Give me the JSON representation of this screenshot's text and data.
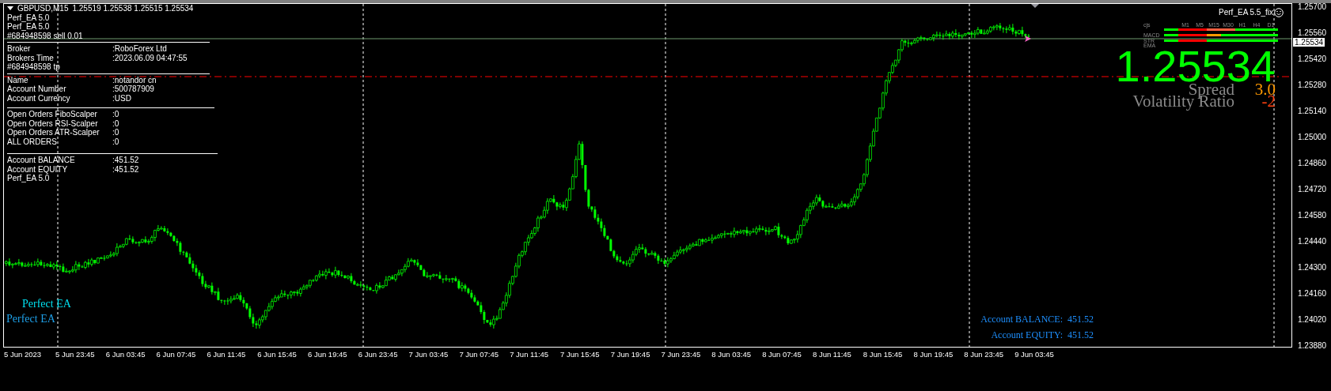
{
  "chart_header": {
    "symbol": "GBPUSD,M15",
    "quotes": "1.25519 1.25538 1.25515 1.25534"
  },
  "ea_labels": [
    "Perf_EA 5.0",
    "Perf_EA 5.0"
  ],
  "order_labels": [
    {
      "kind": "entry",
      "text": "#684948598 sell 0.01"
    },
    {
      "kind": "tp",
      "text": "#684948598 tp"
    }
  ],
  "info_sections": [
    {
      "rows": [
        {
          "label": "Broker",
          "value": ":RoboForex Ltd"
        },
        {
          "label": "Brokers Time",
          "value": ":2023.06.09 04:47:55"
        }
      ]
    },
    {
      "rows": [
        {
          "label": "Name",
          "value": ":notandor cn"
        },
        {
          "label": "Account Number",
          "value": ":500787909"
        },
        {
          "label": "Account Currency",
          "value": ":USD"
        }
      ]
    },
    {
      "rows": [
        {
          "label": "Open Orders FiboScalper",
          "value": ":0"
        },
        {
          "label": "Open Orders RSI-Scalper",
          "value": ":0"
        },
        {
          "label": "Open Orders ATR-Scalper",
          "value": ":0"
        },
        {
          "label": "ALL ORDERS",
          "value": ":0"
        }
      ]
    },
    {
      "rows": [
        {
          "label": "Account BALANCE",
          "value": ":451.52"
        },
        {
          "label": "Account EQUITY",
          "value": ":451.52"
        }
      ]
    }
  ],
  "footer_label": "Perf_EA 5.0",
  "ea_title": "Perf_EA 5.5_fix",
  "signal_matrix": {
    "corner": "cjs",
    "timeframes": [
      "M1",
      "M5",
      "M15",
      "M30",
      "H1",
      "H4",
      "D1"
    ],
    "bars": [
      {
        "cells": [
          {
            "color": "#00ff00"
          },
          {
            "color": "#ff0000"
          },
          {
            "color": "#ff0000"
          },
          {
            "color": "#ff6040"
          },
          {
            "color": "#ff6040"
          },
          {
            "color": "#00ff00"
          },
          {
            "color": "#00ff00"
          },
          {
            "color": "#00ff00"
          }
        ]
      },
      {
        "cells": [
          {
            "color": "#00ff00"
          },
          {
            "color": "#ff0000"
          },
          {
            "color": "#ff0000"
          },
          {
            "color": "#ff9900"
          },
          {
            "color": "#00ff00"
          },
          {
            "color": "#00ff00"
          },
          {
            "color": "#00ff00"
          },
          {
            "color": "#00ff00"
          }
        ]
      },
      {
        "cells": [
          {
            "color": "#00ff00"
          },
          {
            "color": "#ff0000"
          },
          {
            "color": "#ff0000"
          },
          {
            "color": "#00ff00"
          },
          {
            "color": "#00ff00"
          },
          {
            "color": "#00ff00"
          },
          {
            "color": "#00ff00"
          },
          {
            "color": "#00ff00"
          }
        ]
      }
    ],
    "labels": [
      "MACD",
      "STR",
      "EMA"
    ]
  },
  "price_display": {
    "bid": "1.25534",
    "spread_label": "Spread",
    "spread": "3.0",
    "volatility_label": "Volatility Ratio",
    "volatility": "-2"
  },
  "bottom_labels": [
    {
      "text": "Perfect EA",
      "color": "#00e0f0"
    },
    {
      "text": "Perfect EA",
      "color": "#1ea0e8"
    }
  ],
  "account_summary": [
    {
      "label": "Account BALANCE:",
      "value": "451.52"
    },
    {
      "label": "Account EQUITY:",
      "value": "451.52"
    }
  ],
  "price_axis": {
    "labels": [
      "1.25700",
      "1.25560",
      "1.25420",
      "1.25280",
      "1.25140",
      "1.25000",
      "1.24860",
      "1.24720",
      "1.24580",
      "1.24440",
      "1.24300",
      "1.24160",
      "1.24020",
      "1.23880"
    ],
    "current_price": "1.25534"
  },
  "time_axis": {
    "labels": [
      "5 Jun 2023",
      "5 Jun 23:45",
      "6 Jun 03:45",
      "6 Jun 07:45",
      "6 Jun 11:45",
      "6 Jun 15:45",
      "6 Jun 19:45",
      "6 Jun 23:45",
      "7 Jun 03:45",
      "7 Jun 07:45",
      "7 Jun 11:45",
      "7 Jun 15:45",
      "7 Jun 19:45",
      "7 Jun 23:45",
      "8 Jun 03:45",
      "8 Jun 07:45",
      "8 Jun 11:45",
      "8 Jun 15:45",
      "8 Jun 19:45",
      "8 Jun 23:45",
      "9 Jun 03:45"
    ]
  }
}
